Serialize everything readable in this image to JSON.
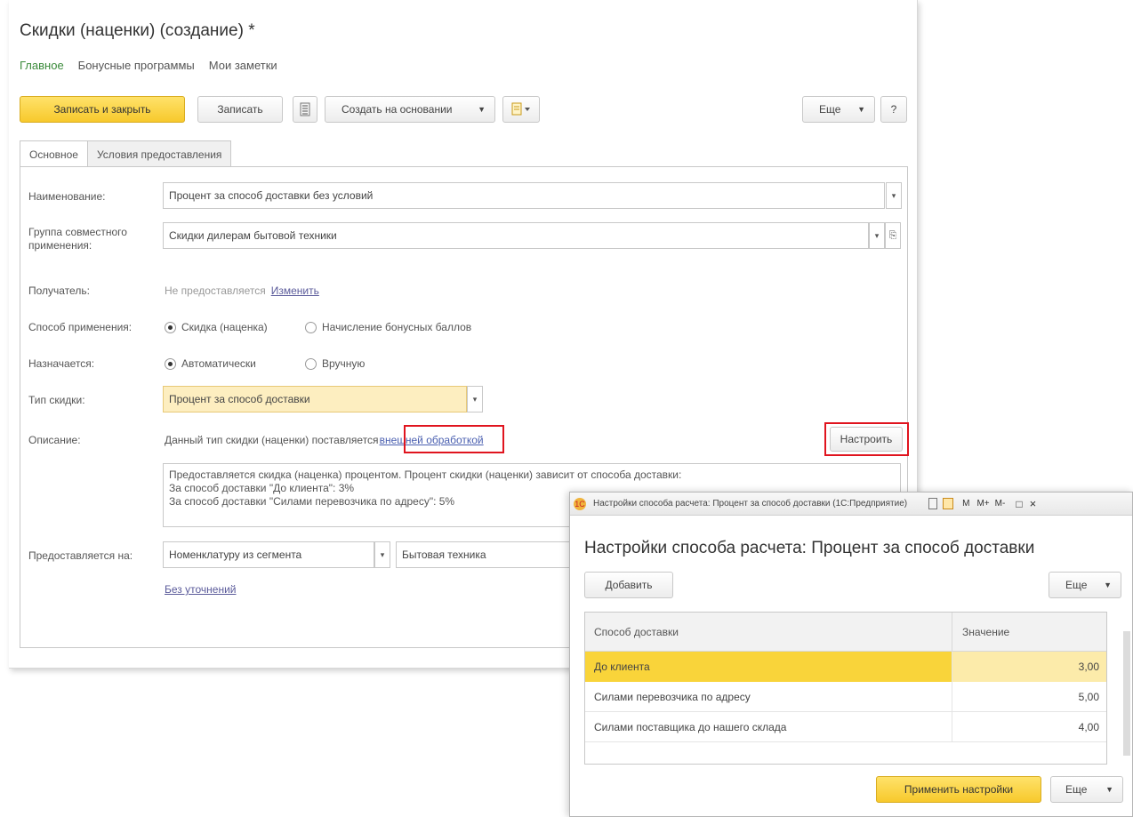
{
  "main": {
    "title": "Скидки (наценки) (создание) *",
    "nav": [
      "Главное",
      "Бонусные программы",
      "Мои заметки"
    ],
    "toolbar": {
      "save_close": "Записать и закрыть",
      "save": "Записать",
      "create_based": "Создать на основании",
      "more": "Еще",
      "help": "?"
    },
    "tabs": [
      "Основное",
      "Условия предоставления"
    ],
    "form": {
      "name_label": "Наименование:",
      "name_value": "Процент за способ доставки без условий",
      "group_label": "Группа совместного применения:",
      "group_value": "Скидки дилерам бытовой техники",
      "recipient_label": "Получатель:",
      "recipient_value": "Не предоставляется",
      "recipient_change": "Изменить",
      "method_label": "Способ применения:",
      "method_option1": "Скидка (наценка)",
      "method_option2": "Начисление бонусных баллов",
      "assigned_label": "Назначается:",
      "assigned_option1": "Автоматически",
      "assigned_option2": "Вручную",
      "type_label": "Тип скидки:",
      "type_value": "Процент за способ доставки",
      "desc_label": "Описание:",
      "desc_text": "Данный тип скидки (наценки) поставляется",
      "desc_link": "внешней обработкой",
      "configure": "Настроить",
      "desc_line1": "Предоставляется скидка (наценка) процентом. Процент скидки (наценки) зависит от способа доставки:",
      "desc_line2": "За способ доставки \"До клиента\": 3%",
      "desc_line3": "За способ доставки \"Силами перевозчика по адресу\": 5%",
      "provided_label": "Предоставляется на:",
      "provided_value1": "Номенклатуру из сегмента",
      "provided_value2": "Бытовая техника",
      "no_refinement": "Без уточнений"
    }
  },
  "dialog": {
    "titlebar": "Настройки способа расчета: Процент за способ доставки  (1С:Предприятие)",
    "titlebar_buttons": [
      "M",
      "M+",
      "M-",
      "□",
      "×"
    ],
    "heading": "Настройки способа расчета: Процент за способ доставки",
    "add": "Добавить",
    "more": "Еще",
    "col1": "Способ доставки",
    "col2": "Значение",
    "rows": [
      {
        "method": "До клиента",
        "value": "3,00"
      },
      {
        "method": "Силами перевозчика по адресу",
        "value": "5,00"
      },
      {
        "method": "Силами поставщика до нашего склада",
        "value": "4,00"
      }
    ],
    "apply": "Применить настройки",
    "more2": "Еще"
  }
}
